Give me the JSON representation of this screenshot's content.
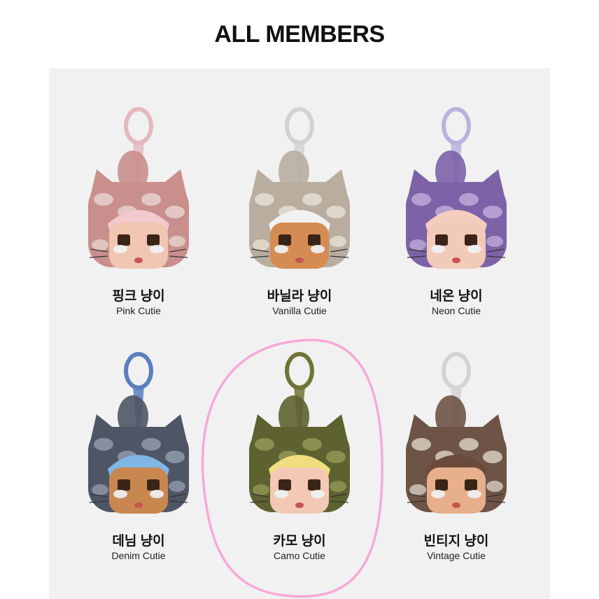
{
  "header": {
    "title": "ALL MEMBERS"
  },
  "members": [
    {
      "korean": "핑크 냥이",
      "english": "Pink Cutie",
      "ring_color": "#e4b8bd",
      "fur_color": "#c98f8c",
      "fur_light": "#eadbd5",
      "hair_color": "#f2c9cd",
      "skin_color": "#f0c6b3"
    },
    {
      "korean": "바닐라 냥이",
      "english": "Vanilla Cutie",
      "ring_color": "#d2d2d4",
      "fur_color": "#b8ad9e",
      "fur_light": "#ece6da",
      "hair_color": "#f2f2f2",
      "skin_color": "#d58c52"
    },
    {
      "korean": "네온 냥이",
      "english": "Neon Cutie",
      "ring_color": "#b9b3dc",
      "fur_color": "#7d62a8",
      "fur_light": "#c8b4e0",
      "hair_color": "#f3cdbf",
      "skin_color": "#f2cab8"
    },
    {
      "korean": "데님 냥이",
      "english": "Denim Cutie",
      "ring_color": "#5b7ec1",
      "fur_color": "#4e5565",
      "fur_light": "#9aa4b6",
      "hair_color": "#7eb6e6",
      "skin_color": "#c98750"
    },
    {
      "korean": "카모 냥이",
      "english": "Camo Cutie",
      "ring_color": "#6f7434",
      "fur_color": "#5d6230",
      "fur_light": "#9aa05a",
      "hair_color": "#f0de7e",
      "skin_color": "#f3c9b6"
    },
    {
      "korean": "빈티지 냥이",
      "english": "Vintage Cutie",
      "ring_color": "#d4d3d3",
      "fur_color": "#6e5446",
      "fur_light": "#e7ddd3",
      "hair_color": "#6a4a3a",
      "skin_color": "#e7b08a"
    }
  ],
  "highlight_color": "#f7a8d8"
}
